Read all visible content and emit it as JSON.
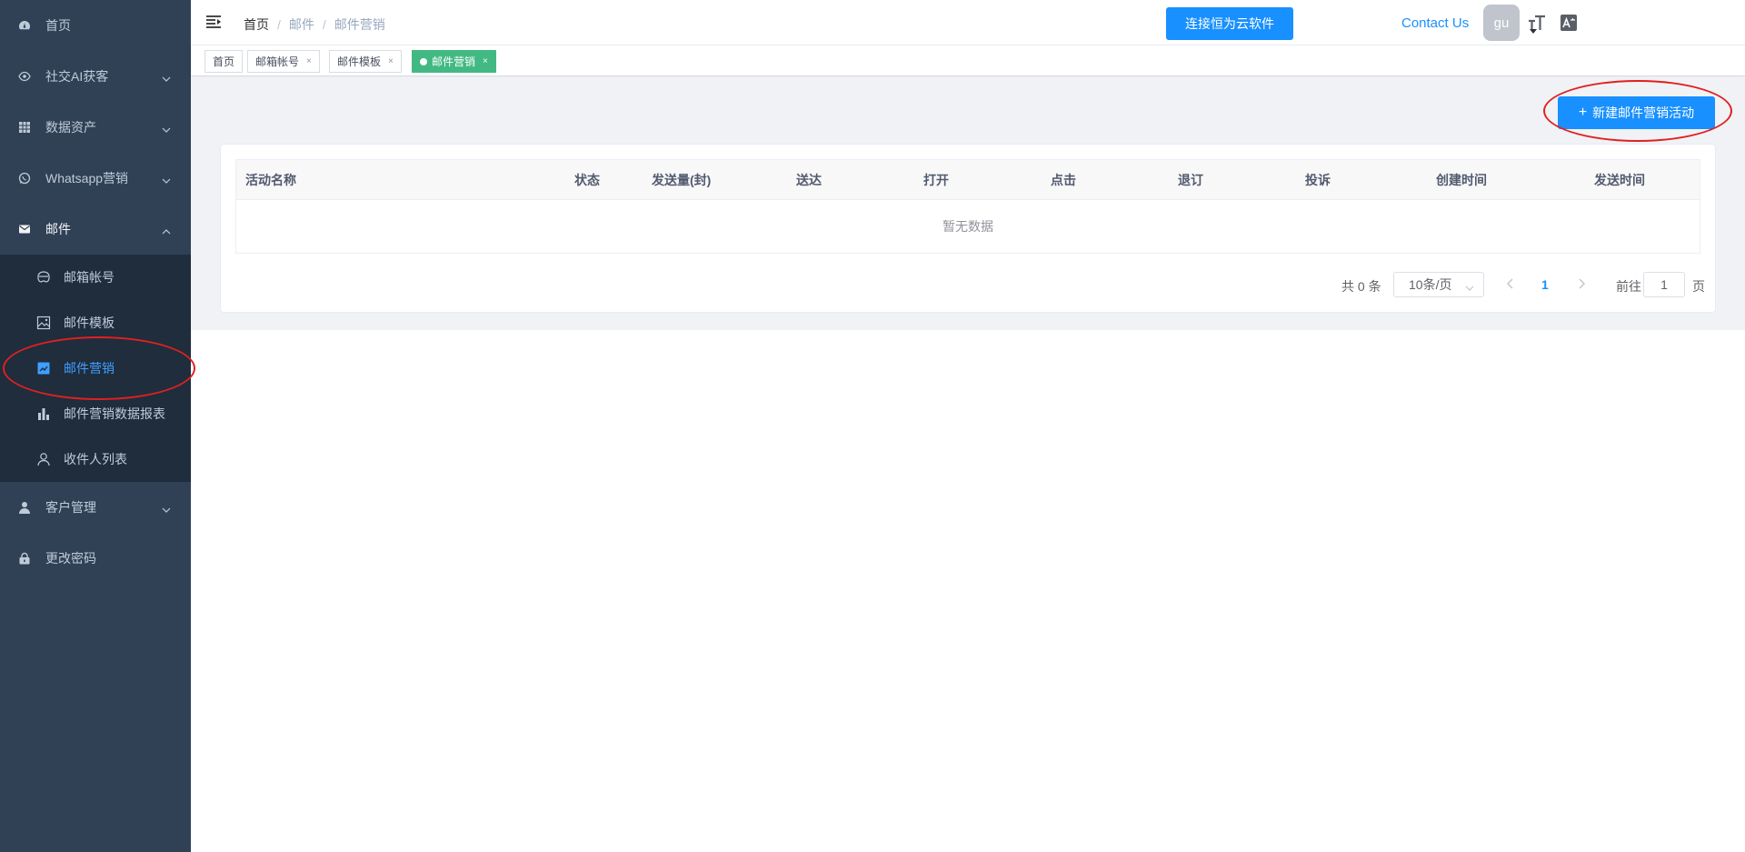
{
  "sidebar": {
    "items": [
      {
        "label": "首页",
        "icon": "dashboard-icon"
      },
      {
        "label": "社交AI获客",
        "icon": "eye-icon"
      },
      {
        "label": "数据资产",
        "icon": "table-icon"
      },
      {
        "label": "Whatsapp营销",
        "icon": "whatsapp-icon"
      },
      {
        "label": "邮件",
        "icon": "mail-icon"
      },
      {
        "label": "客户管理",
        "icon": "user-icon"
      },
      {
        "label": "更改密码",
        "icon": "lock-icon"
      }
    ],
    "mail_sub": [
      {
        "label": "邮箱帐号",
        "icon": "mask-icon"
      },
      {
        "label": "邮件模板",
        "icon": "image-icon"
      },
      {
        "label": "邮件营销",
        "icon": "chart-icon"
      },
      {
        "label": "邮件营销数据报表",
        "icon": "bar-chart-icon"
      },
      {
        "label": "收件人列表",
        "icon": "person-icon"
      }
    ]
  },
  "navbar": {
    "breadcrumb": [
      "首页",
      "邮件",
      "邮件营销"
    ],
    "connect_button": "连接恒为云软件",
    "contact": "Contact Us",
    "avatar": "gu"
  },
  "tags": [
    {
      "label": "首页"
    },
    {
      "label": "邮箱帐号",
      "close": "×"
    },
    {
      "label": "邮件模板",
      "close": "×"
    },
    {
      "label": "邮件营销",
      "close": "×",
      "active": true
    }
  ],
  "main": {
    "new_button": "新建邮件营销活动",
    "table": {
      "columns": [
        "活动名称",
        "状态",
        "发送量(封)",
        "送达",
        "打开",
        "点击",
        "退订",
        "投诉",
        "创建时间",
        "发送时间"
      ],
      "empty_text": "暂无数据"
    },
    "pagination": {
      "total": "共 0 条",
      "page_size": "10条/页",
      "current": "1",
      "goto_label": "前往",
      "goto_value": "1",
      "page_suffix": "页"
    }
  },
  "colors": {
    "sidebar_bg": "#304156",
    "sidebar_sub_bg": "#1f2d3d",
    "primary": "#1890ff",
    "tag_active": "#42b983",
    "annotation": "#e02020"
  }
}
